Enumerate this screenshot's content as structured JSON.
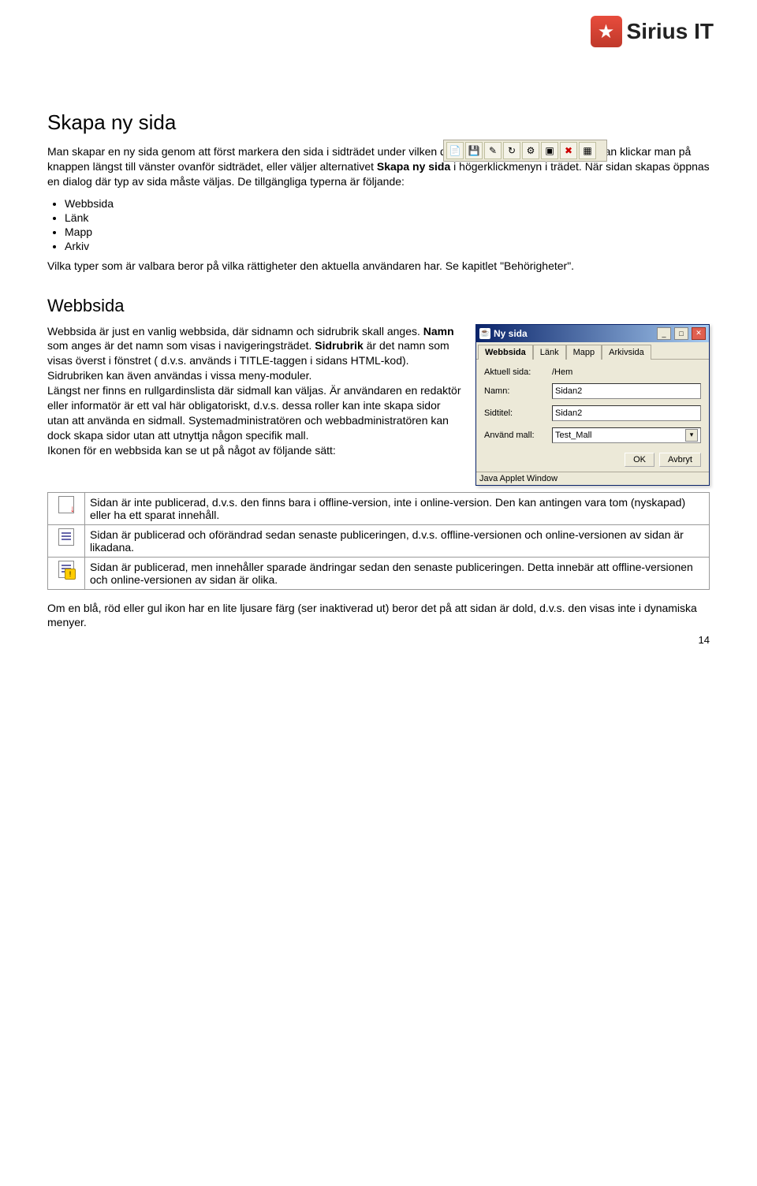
{
  "logo": {
    "brand": "Sirius IT"
  },
  "headings": {
    "h1": "Skapa ny sida",
    "h2": "Webbsida"
  },
  "intro": {
    "p1a": "Man skapar en ny sida genom att först markera den sida i sidträdet under vilken den nya sidan skall placeras. Sedan klickar man på knappen längst till vänster ovanför sidträdet, eller väljer alternativet ",
    "p1b": "Skapa ny sida",
    "p1c": " i högerklickmenyn i trädet. När sidan skapas öppnas en dialog där typ av sida måste väljas. De tillgängliga typerna är följande:",
    "types": [
      "Webbsida",
      "Länk",
      "Mapp",
      "Arkiv"
    ],
    "p2": "Vilka typer som är valbara beror på vilka rättigheter den aktuella användaren har. Se kapitlet \"Behörigheter\"."
  },
  "webbsida": {
    "para_parts": [
      {
        "t": "Webbsida är just en vanlig webbsida, där sidnamn och sidrubrik skall anges. "
      },
      {
        "t": "Namn",
        "b": true
      },
      {
        "t": " som anges är det namn som visas i navigeringsträdet. "
      },
      {
        "t": "Sidrubrik",
        "b": true
      },
      {
        "t": " är det namn som visas  överst i fönstret ( d.v.s. används i TITLE-taggen i sidans HTML-kod). Sidrubriken kan även användas i vissa meny-moduler."
      },
      {
        "br": true
      },
      {
        "t": "Längst ner finns en rullgardinslista där sidmall kan väljas. Är användaren en redaktör eller informatör är ett val här obligatoriskt, d.v.s. dessa roller kan inte skapa sidor utan att använda en sidmall. Systemadministratören och webbadministratören kan dock skapa sidor utan att utnyttja någon specifik mall."
      },
      {
        "br": true
      },
      {
        "t": "Ikonen för en webbsida kan se ut på något av följande sätt:"
      }
    ]
  },
  "dialog": {
    "title": "Ny sida",
    "tabs": [
      "Webbsida",
      "Länk",
      "Mapp",
      "Arkivsida"
    ],
    "labels": {
      "aktuell": "Aktuell sida:",
      "namn": "Namn:",
      "sidtitel": "Sidtitel:",
      "mall": "Använd mall:"
    },
    "values": {
      "aktuell": "/Hem",
      "namn": "Sidan2",
      "sidtitel": "Sidan2",
      "mall": "Test_Mall"
    },
    "buttons": {
      "ok": "OK",
      "cancel": "Avbryt"
    },
    "status": "Java Applet Window"
  },
  "icon_table": [
    "Sidan är inte publicerad, d.v.s. den finns bara i offline-version, inte i online-version. Den kan antingen vara tom (nyskapad) eller ha ett sparat innehåll.",
    "Sidan är publicerad och oförändrad sedan senaste publiceringen, d.v.s. offline-versionen och online-versionen av sidan är likadana.",
    "Sidan är publicerad, men innehåller sparade ändringar sedan den senaste publiceringen. Detta innebär att offline-versionen och online-versionen av sidan är olika."
  ],
  "footer_note": "Om en blå, röd eller gul ikon har en lite ljusare färg (ser inaktiverad ut) beror det på att sidan är dold, d.v.s. den visas inte i dynamiska menyer.",
  "page_number": "14"
}
